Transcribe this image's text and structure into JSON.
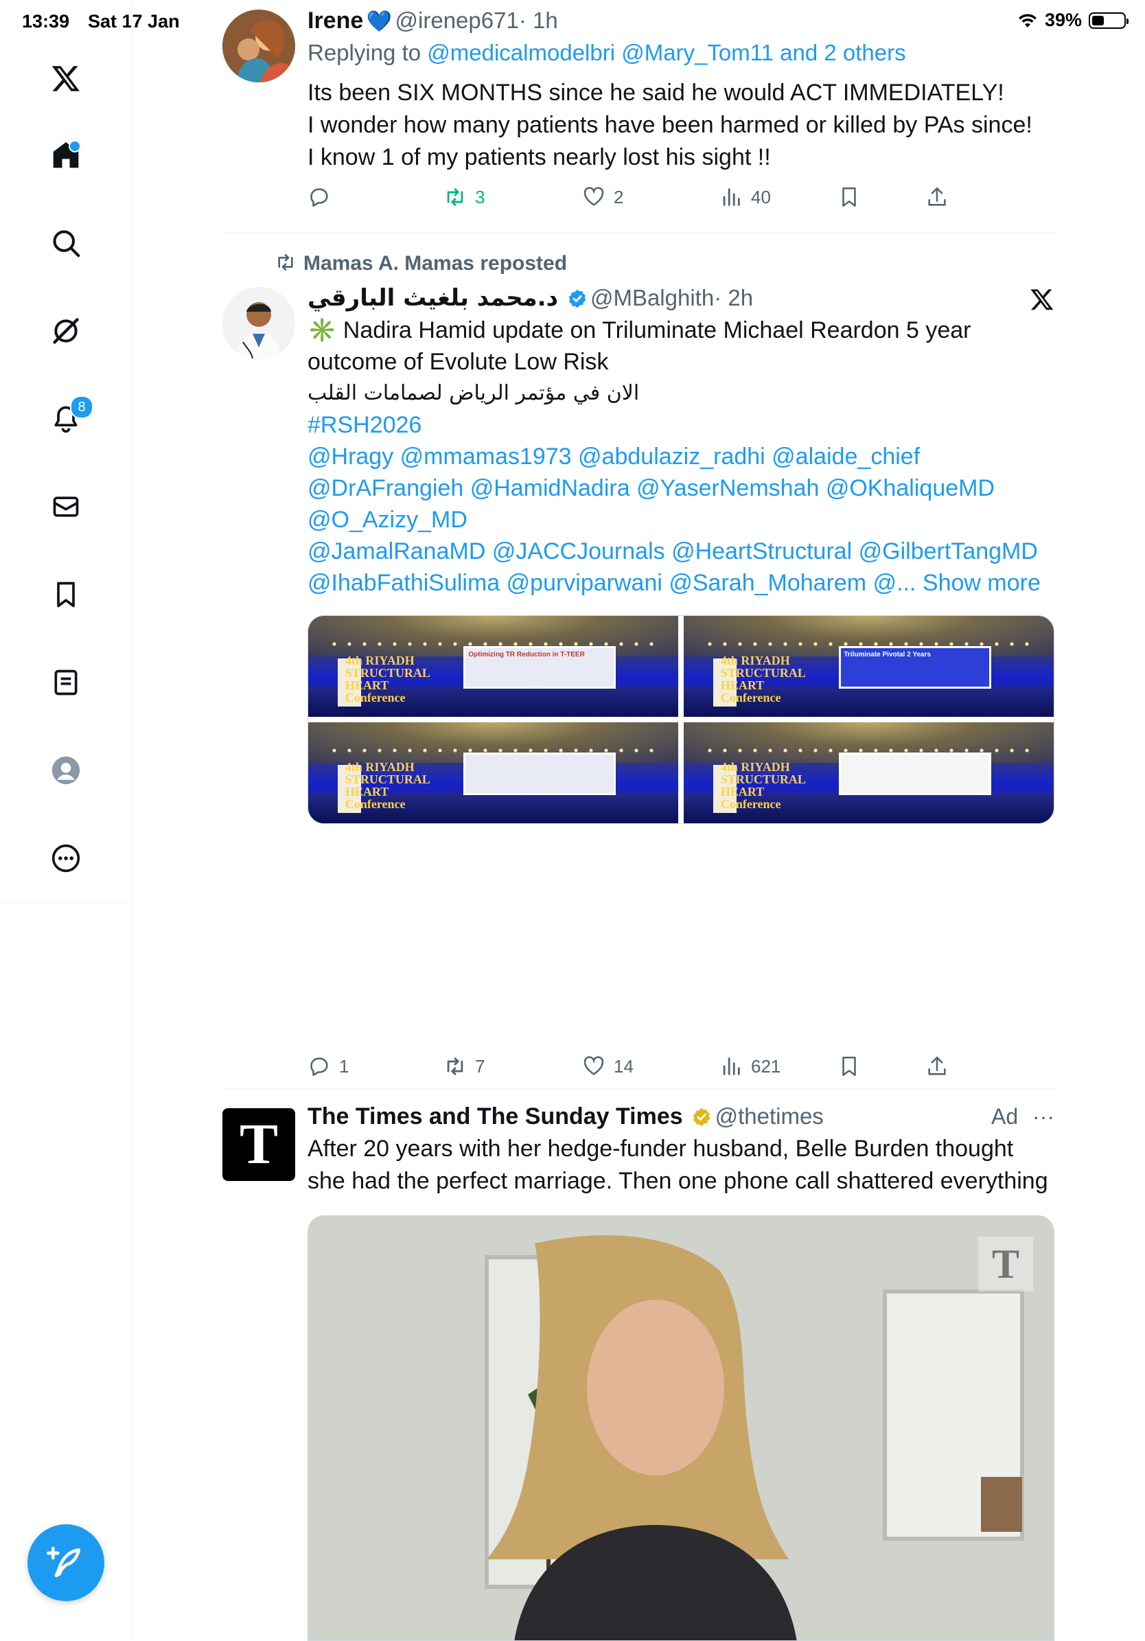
{
  "status_bar": {
    "time": "13:39",
    "date": "Sat 17 Jan",
    "battery": "39%",
    "battery_level": 0.39
  },
  "sidebar": {
    "items": [
      {
        "name": "x-logo-icon"
      },
      {
        "name": "home-icon",
        "has_dot": true
      },
      {
        "name": "search-icon"
      },
      {
        "name": "grok-icon"
      },
      {
        "name": "notifications-icon",
        "badge": "8"
      },
      {
        "name": "messages-icon"
      },
      {
        "name": "bookmarks-icon"
      },
      {
        "name": "lists-icon"
      },
      {
        "name": "profile-icon"
      },
      {
        "name": "more-icon"
      }
    ],
    "compose_button": "compose-icon"
  },
  "accent_color": "#1d9bf0",
  "tweets": [
    {
      "display_name": "Irene",
      "name_emoji": "💙",
      "handle": "@irenep671",
      "time": "· 1h",
      "reply_prefix": "Replying to",
      "reply_to": "@medicalmodelbri @Mary_Tom11 and 2 others",
      "lines": [
        "Its been SIX MONTHS since he said he would ACT IMMEDIATELY!",
        "I wonder how many patients have been harmed or killed by PAs since!",
        "I know 1 of my patients nearly lost his sight !!"
      ],
      "stats": {
        "replies": "",
        "reposts": "3",
        "likes": "2",
        "views": "40"
      }
    },
    {
      "repost_label": "Mamas A. Mamas reposted",
      "display_name": "د.محمد بلغيث البارقي",
      "handle": "@MBalghith",
      "time": "· 2h",
      "line1": "✳️ Nadira Hamid update on Triluminate Michael Reardon 5 year",
      "line2": "outcome of Evolute Low Risk",
      "line3": "الان في مؤتمر الرياض لصمامات القلب",
      "hashtag": "#RSH2026",
      "mentions": [
        "@Hragy @mmamas1973 @abdulaziz_radhi @alaide_chief",
        "@DrAFrangieh @HamidNadira @YaserNemshah @OKhaliqueMD",
        "@O_Azizy_MD",
        "@JamalRanaMD @JACCJournals @HeartStructural @GilbertTangMD",
        "@IhabFathiSulima @purviparwani @Sarah_Moharem @..."
      ],
      "show_more": "Show more",
      "photos": [
        {
          "screen_title": "Optimizing TR Reduction in T-TEER",
          "logo": "4th RIYADH STRUCTURAL HEART Conference"
        },
        {
          "screen_title": "Triluminate Pivotal 2 Years",
          "logo": "4th RIYADH STRUCTURAL HEART Conference"
        },
        {
          "screen_title": "",
          "logo": "4th RIYADH STRUCTURAL HEART Conference"
        },
        {
          "screen_title": "",
          "logo": "4th RIYADH STRUCTURAL HEART Conference"
        }
      ],
      "stats": {
        "replies": "1",
        "reposts": "7",
        "likes": "14",
        "views": "621"
      }
    },
    {
      "display_name": "The Times and The Sunday Times",
      "handle": "@thetimes",
      "ad_label": "Ad",
      "more": "···",
      "avatar_letter": "T",
      "line1": "After 20 years with her hedge-funder husband, Belle Burden thought",
      "line2": "she had the perfect marriage. Then one phone call shattered everything",
      "image_watermark": "T"
    }
  ]
}
